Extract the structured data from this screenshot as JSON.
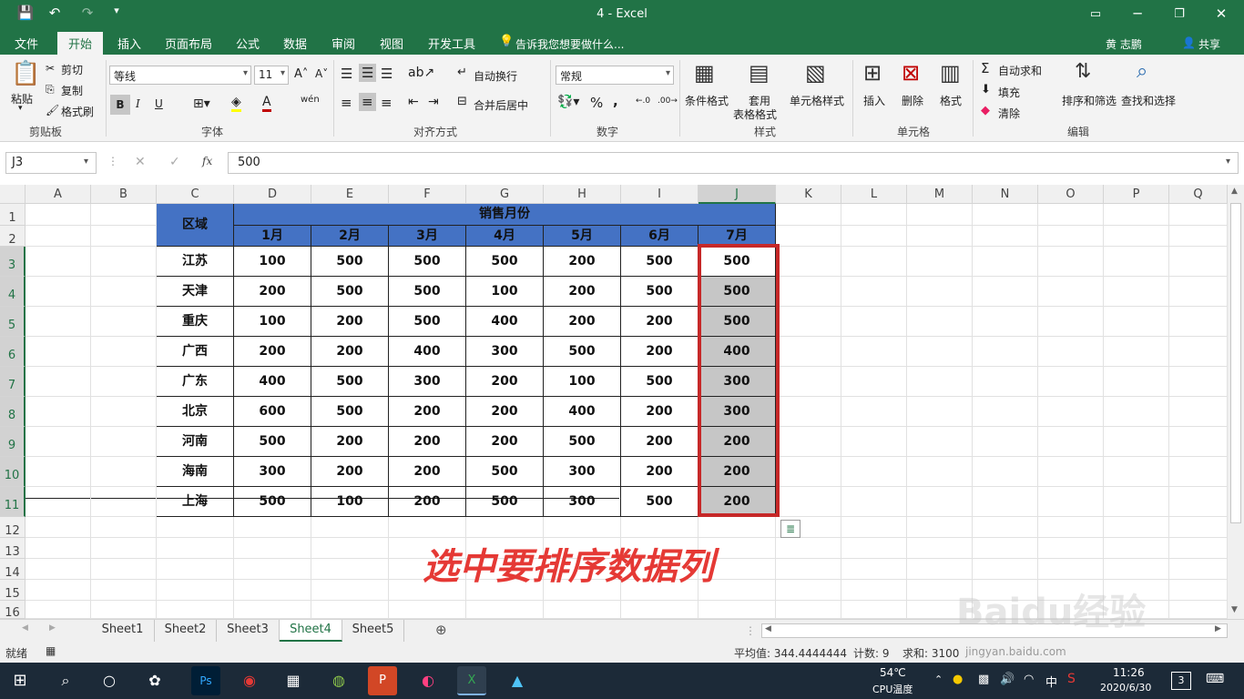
{
  "window": {
    "title": "4 - Excel"
  },
  "quick_access": {
    "save_icon": "save-icon",
    "undo_icon": "undo-icon",
    "redo_icon": "redo-icon",
    "customize_icon": "dropdown-icon"
  },
  "account": {
    "user": "黄 志鹏",
    "share": "共享",
    "tell_me": "告诉我您想要做什么..."
  },
  "ribbon_tabs": [
    "文件",
    "开始",
    "插入",
    "页面布局",
    "公式",
    "数据",
    "审阅",
    "视图",
    "开发工具"
  ],
  "active_tab": "开始",
  "clipboard": {
    "paste": "粘贴",
    "cut": "剪切",
    "copy": "复制",
    "format_painter": "格式刷",
    "label": "剪贴板"
  },
  "font": {
    "name": "等线",
    "size": "11",
    "label": "字体",
    "bold": "B",
    "italic": "I",
    "underline": "U",
    "font_color": "#c00000",
    "fill_color": "#ffff00"
  },
  "alignment": {
    "wrap": "自动换行",
    "merge": "合并后居中",
    "label": "对齐方式"
  },
  "number": {
    "format": "常规",
    "label": "数字",
    "percent": "%",
    "comma": ","
  },
  "styles": {
    "conditional": "条件格式",
    "table_line1": "套用",
    "table_line2": "表格格式",
    "cell_styles": "单元格样式",
    "label": "样式"
  },
  "cells_group": {
    "insert": "插入",
    "delete": "删除",
    "format": "格式",
    "label": "单元格"
  },
  "editing": {
    "autosum": "自动求和",
    "fill": "填充",
    "clear": "清除",
    "sort": "排序和筛选",
    "find": "查找和选择",
    "label": "编辑"
  },
  "formula_bar": {
    "name_box": "J3",
    "fx": "fx",
    "value": "500"
  },
  "columns": [
    "A",
    "B",
    "C",
    "D",
    "E",
    "F",
    "G",
    "H",
    "I",
    "J",
    "K",
    "L",
    "M",
    "N",
    "O",
    "P",
    "Q"
  ],
  "selected_column": "J",
  "rows": [
    "1",
    "2",
    "3",
    "4",
    "5",
    "6",
    "7",
    "8",
    "9",
    "10",
    "11",
    "12",
    "13",
    "14",
    "15",
    "16"
  ],
  "table": {
    "region_header": "区域",
    "group_header": "销售月份",
    "months": [
      "1月",
      "2月",
      "3月",
      "4月",
      "5月",
      "6月",
      "7月"
    ],
    "data": [
      {
        "region": "江苏",
        "values": [
          "100",
          "500",
          "500",
          "500",
          "200",
          "500",
          "500"
        ]
      },
      {
        "region": "天津",
        "values": [
          "200",
          "500",
          "500",
          "100",
          "200",
          "500",
          "500"
        ]
      },
      {
        "region": "重庆",
        "values": [
          "100",
          "200",
          "500",
          "400",
          "200",
          "200",
          "500"
        ]
      },
      {
        "region": "广西",
        "values": [
          "200",
          "200",
          "400",
          "300",
          "500",
          "200",
          "400"
        ]
      },
      {
        "region": "广东",
        "values": [
          "400",
          "500",
          "300",
          "200",
          "100",
          "500",
          "300"
        ]
      },
      {
        "region": "北京",
        "values": [
          "600",
          "500",
          "200",
          "200",
          "400",
          "200",
          "300"
        ]
      },
      {
        "region": "河南",
        "values": [
          "500",
          "200",
          "200",
          "200",
          "500",
          "200",
          "200"
        ]
      },
      {
        "region": "海南",
        "values": [
          "300",
          "200",
          "200",
          "500",
          "300",
          "200",
          "200"
        ]
      },
      {
        "region": "上海",
        "values": [
          "500",
          "100",
          "200",
          "500",
          "300",
          "500",
          "200"
        ]
      }
    ]
  },
  "annotation": "选中要排序数据列",
  "sheets": [
    "Sheet1",
    "Sheet2",
    "Sheet3",
    "Sheet4",
    "Sheet5"
  ],
  "active_sheet": "Sheet4",
  "status": {
    "ready": "就绪",
    "average": "平均值: 344.4444444",
    "count": "计数: 9",
    "sum": "求和: 3100"
  },
  "watermark": {
    "text": "Baidu经验",
    "url": "jingyan.baidu.com"
  },
  "taskbar": {
    "temp": "54℃",
    "temp_label": "CPU温度",
    "time": "11:26",
    "date": "2020/6/30",
    "ime": "中",
    "notifications": "3"
  }
}
